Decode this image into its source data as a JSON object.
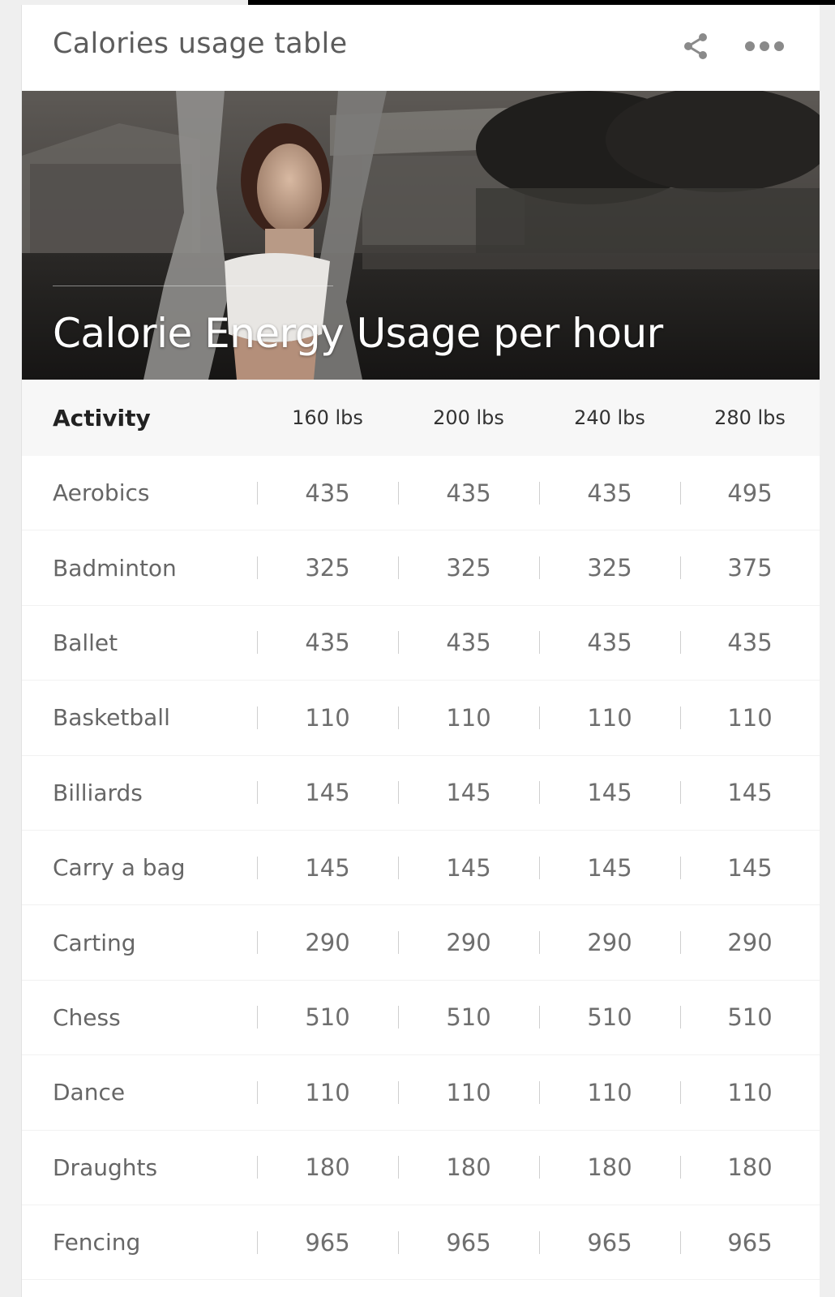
{
  "card": {
    "title": "Calories usage table"
  },
  "icons": {
    "share": "share-icon",
    "more": "more-horizontal-icon"
  },
  "hero": {
    "title": "Calorie Energy Usage per hour"
  },
  "table": {
    "headers": [
      "Activity",
      "160 lbs",
      "200 lbs",
      "240 lbs",
      "280 lbs"
    ],
    "rows": [
      {
        "activity": "Aerobics",
        "values": [
          "435",
          "435",
          "435",
          "495"
        ]
      },
      {
        "activity": "Badminton",
        "values": [
          "325",
          "325",
          "325",
          "375"
        ]
      },
      {
        "activity": "Ballet",
        "values": [
          "435",
          "435",
          "435",
          "435"
        ]
      },
      {
        "activity": "Basketball",
        "values": [
          "110",
          "110",
          "110",
          "110"
        ]
      },
      {
        "activity": "Billiards",
        "values": [
          "145",
          "145",
          "145",
          "145"
        ]
      },
      {
        "activity": "Carry a bag",
        "values": [
          "145",
          "145",
          "145",
          "145"
        ]
      },
      {
        "activity": "Carting",
        "values": [
          "290",
          "290",
          "290",
          "290"
        ]
      },
      {
        "activity": "Chess",
        "values": [
          "510",
          "510",
          "510",
          "510"
        ]
      },
      {
        "activity": "Dance",
        "values": [
          "110",
          "110",
          "110",
          "110"
        ]
      },
      {
        "activity": "Draughts",
        "values": [
          "180",
          "180",
          "180",
          "180"
        ]
      },
      {
        "activity": "Fencing",
        "values": [
          "965",
          "965",
          "965",
          "965"
        ]
      }
    ]
  },
  "colors": {
    "title_text": "#5c5c5c",
    "header_bg": "#f7f7f7",
    "row_text": "#666666",
    "hero_text": "#ffffff"
  }
}
